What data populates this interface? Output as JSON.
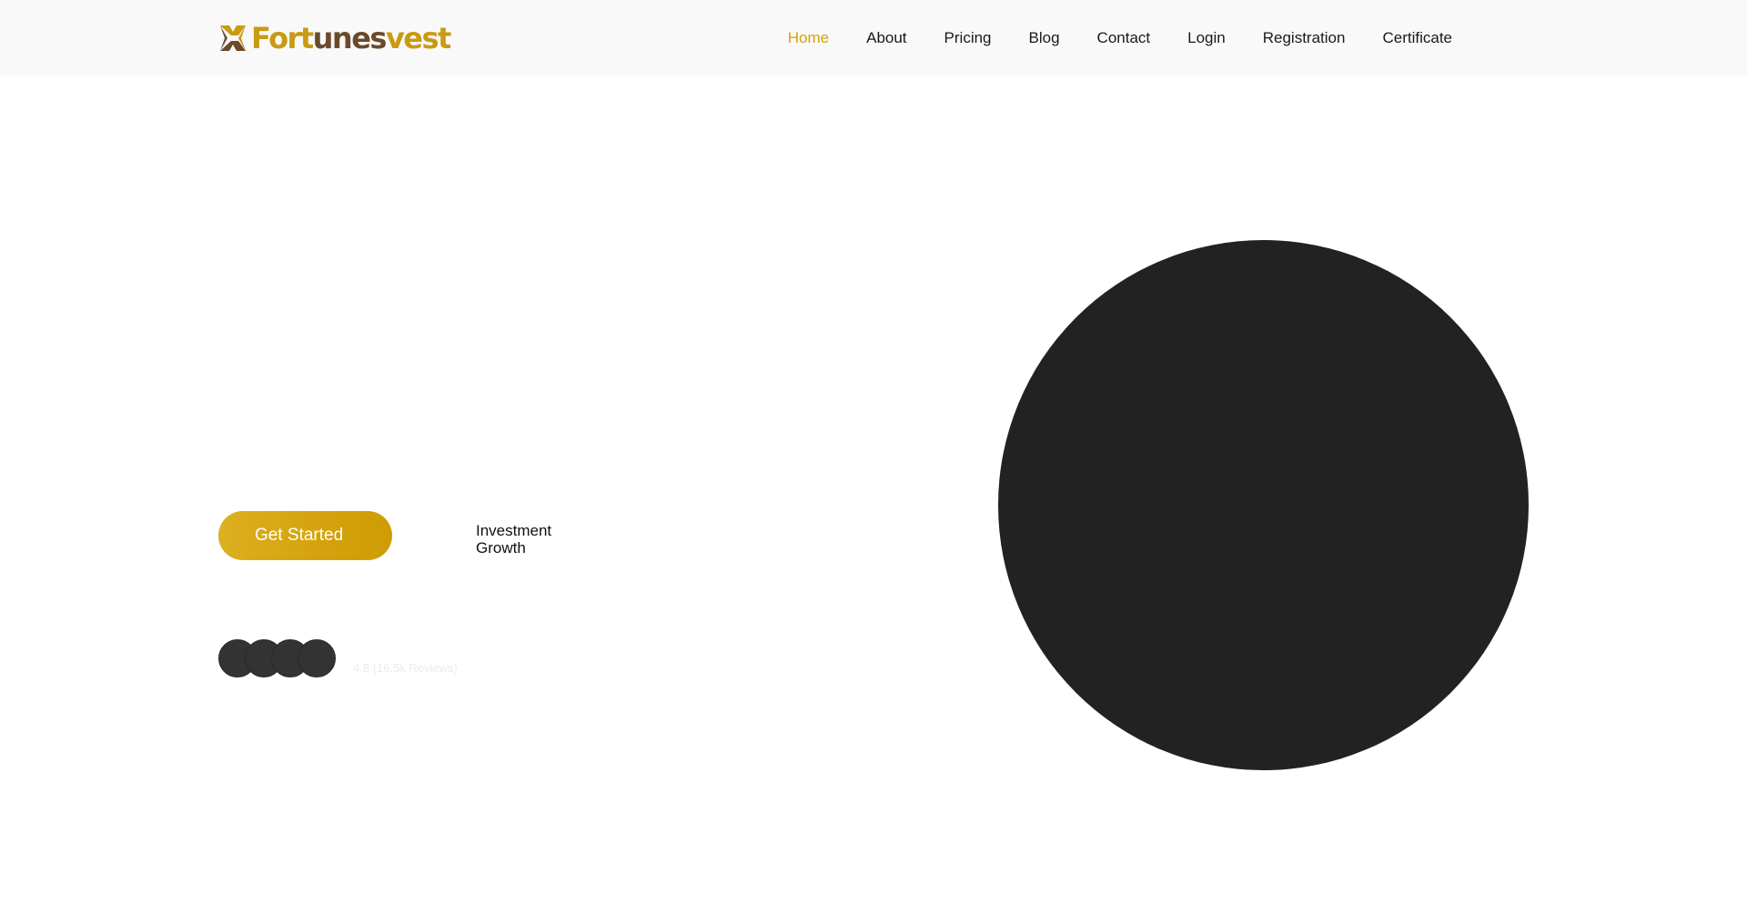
{
  "header": {
    "logo": {
      "parts": [
        "Fort",
        "unes",
        "vest"
      ],
      "icon": "brand-x-icon",
      "colors": {
        "gold": "#c99a12",
        "brown": "#6b4a2b"
      }
    },
    "nav": [
      {
        "label": "Home",
        "active": true
      },
      {
        "label": "About",
        "active": false
      },
      {
        "label": "Pricing",
        "active": false
      },
      {
        "label": "Blog",
        "active": false
      },
      {
        "label": "Contact",
        "active": false
      },
      {
        "label": "Login",
        "active": false
      },
      {
        "label": "Registration",
        "active": false
      },
      {
        "label": "Certificate",
        "active": false
      }
    ],
    "accent_color": "#d4a20c"
  },
  "hero": {
    "cta_label": "Get Started",
    "stat_label": "Investment Growth",
    "reviews_text": "4.8 (16.5k Reviews)",
    "avatar_count": 4
  }
}
